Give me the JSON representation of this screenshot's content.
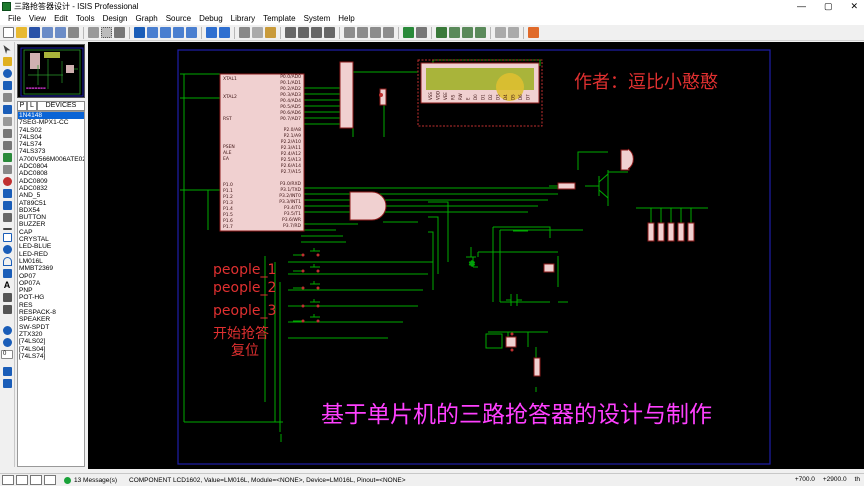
{
  "window": {
    "title": "三路抢答器设计 - ISIS Professional",
    "controls": [
      "—",
      "▢",
      "✕"
    ]
  },
  "menu": [
    "File",
    "View",
    "Edit",
    "Tools",
    "Design",
    "Graph",
    "Source",
    "Debug",
    "Library",
    "Template",
    "System",
    "Help"
  ],
  "selector": {
    "p_label": "P",
    "l_label": "L",
    "header": "DEVICES",
    "devices": [
      "1N4148",
      "7SEG-MPX1-CC",
      "74LS02",
      "74LS04",
      "74LS74",
      "74LS373",
      "A700V566M006ATE028",
      "ADC0804",
      "ADC0808",
      "ADC0809",
      "ADC0832",
      "AND_5",
      "AT89C51",
      "BDX54",
      "BUTTON",
      "BUZZER",
      "CAP",
      "CRYSTAL",
      "LED-BLUE",
      "LED-RED",
      "LM016L",
      "MMBT2369",
      "OP07",
      "OP07A",
      "PNP",
      "POT-HG",
      "RES",
      "RESPACK-8",
      "SPEAKER",
      "SW-SPDT",
      "ZTX320",
      "[74LS02]",
      "[74LS04]",
      "[74LS74]"
    ],
    "selected_index": 0
  },
  "schematic": {
    "author_label": "作者：逗比小憨憨",
    "project_title": "基于单片机的三路抢答器的设计与制作",
    "buttons": [
      "people_1",
      "people_2",
      "people_3",
      "开始抢答",
      "复位"
    ],
    "mcu_left_pins": [
      "XTAL1",
      "XTAL2",
      "RST",
      "PSEN",
      "ALE",
      "EA",
      "P1.0",
      "P1.1",
      "P1.2",
      "P1.3",
      "P1.4",
      "P1.5",
      "P1.6",
      "P1.7"
    ],
    "mcu_right_pins": [
      "P0.0/AD0",
      "P0.1/AD1",
      "P0.2/AD2",
      "P0.3/AD3",
      "P0.4/AD4",
      "P0.5/AD5",
      "P0.6/AD6",
      "P0.7/AD7",
      "P2.0/A8",
      "P2.1/A9",
      "P2.2/A10",
      "P2.3/A11",
      "P2.4/A12",
      "P2.5/A13",
      "P2.6/A14",
      "P2.7/A15",
      "P3.0/RXD",
      "P3.1/TXD",
      "P3.2/INT0",
      "P3.3/INT1",
      "P3.4/T0",
      "P3.5/T1",
      "P3.6/WR",
      "P3.7/RD"
    ],
    "lcd_pins": [
      "VSS",
      "VDD",
      "VEE",
      "RS",
      "RW",
      "E",
      "D0",
      "D1",
      "D2",
      "D3",
      "D4",
      "D5",
      "D6",
      "D7"
    ]
  },
  "status": {
    "message_count": "13 Message(s)",
    "component_info": "COMPONENT LCD1602, Value=LM016L, Module=<NONE>, Device=LM016L, Pinout=<NONE>",
    "coord_x": "+700.0",
    "coord_y": "+2900.0",
    "unit": "th",
    "rotation_value": "0"
  },
  "colors": {
    "wire": "#00aa00",
    "sheet_border": "#1e1eaa",
    "red_text": "#e03030",
    "magenta_text": "#ff40ff",
    "component_body": "#f0d0d0",
    "component_outline": "#8b1a1a",
    "lcd_screen": "#a9b43a",
    "selection": "#0a64d6"
  }
}
